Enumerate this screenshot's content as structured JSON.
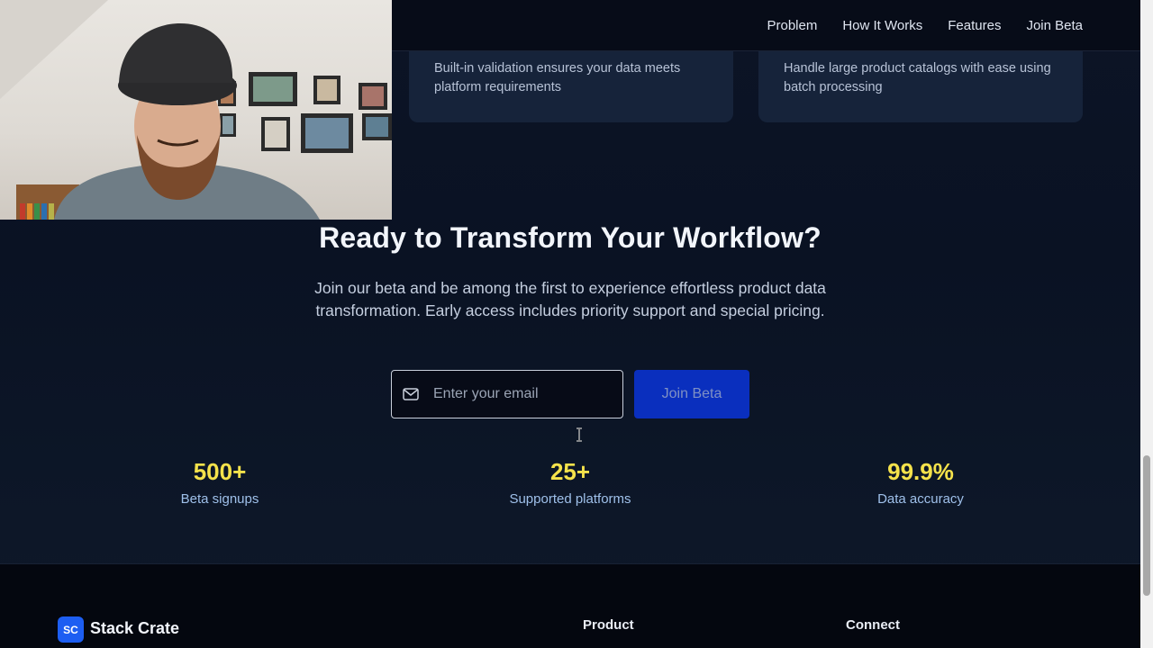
{
  "nav": {
    "links": [
      "Problem",
      "How It Works",
      "Features",
      "Join Beta"
    ]
  },
  "features": {
    "left_desc": "Built-in validation ensures your data meets platform requirements",
    "right_desc": "Handle large product catalogs with ease using batch processing"
  },
  "cta": {
    "title": "Ready to Transform Your Workflow?",
    "subtitle": "Join our beta and be among the first to experience effortless product data transformation. Early access includes priority support and special pricing.",
    "email_placeholder": "Enter your email",
    "email_value": "",
    "button_label": "Join Beta"
  },
  "stats": [
    {
      "value": "500+",
      "label": "Beta signups"
    },
    {
      "value": "25+",
      "label": "Supported platforms"
    },
    {
      "value": "99.9%",
      "label": "Data accuracy"
    }
  ],
  "footer": {
    "logo_badge": "SC",
    "brand": "Stack Crate",
    "columns": [
      "Product",
      "Connect"
    ]
  },
  "colors": {
    "accent_yellow": "#f5e24b",
    "button_blue": "#0a2fbe",
    "brand_blue": "#1d5ef2",
    "stat_label": "#9fc0ea"
  }
}
